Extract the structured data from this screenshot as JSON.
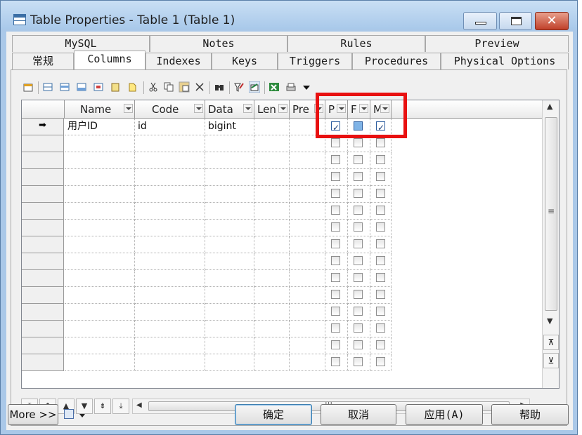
{
  "window": {
    "title": "Table Properties - Table 1 (Table 1)",
    "close_glyph": "✕"
  },
  "tabs": {
    "row1": [
      "MySQL",
      "Notes",
      "Rules",
      "Preview"
    ],
    "row2": [
      "常规",
      "Columns",
      "Indexes",
      "Keys",
      "Triggers",
      "Procedures",
      "Physical Options"
    ],
    "active": "Columns"
  },
  "toolbar": {
    "icons": [
      "properties-icon",
      "add-row-icon",
      "insert-row-icon",
      "add-rows-icon",
      "delete-row-icon",
      "paste-row-icon",
      "new-object-icon",
      "cut-icon",
      "copy-icon",
      "paste-icon",
      "delete-icon",
      "find-icon",
      "filter-icon",
      "customize-columns-icon",
      "excel-export-icon",
      "print-icon",
      "more-dropdown-icon"
    ]
  },
  "grid": {
    "columns": [
      "Name",
      "Code",
      "Data",
      "Len",
      "Pre",
      "P",
      "F",
      "M"
    ],
    "rows": [
      {
        "marker": "➡",
        "name": "用户ID",
        "code": "id",
        "data": "bigint",
        "len": "",
        "pre": "",
        "p": true,
        "f": false,
        "m": true
      }
    ],
    "empty_row_count": 14
  },
  "scrollbars": {
    "vertical": {
      "up": "▲",
      "down": "▼",
      "grip": "≡",
      "page_up": "⊼",
      "page_down": "⊻"
    },
    "horizontal": {
      "left": "◀",
      "right": "▶",
      "grip": "|||"
    }
  },
  "navigation": [
    "⤒",
    "⇞",
    "▲",
    "▼",
    "⇟",
    "⤓"
  ],
  "buttons": {
    "more": "More >>",
    "ok": "确定",
    "cancel": "取消",
    "apply": "应用(A)",
    "help": "帮助"
  },
  "colors": {
    "highlight_box": "#e81010",
    "titlebar": "#aac8e8",
    "close_button": "#c0402a"
  }
}
